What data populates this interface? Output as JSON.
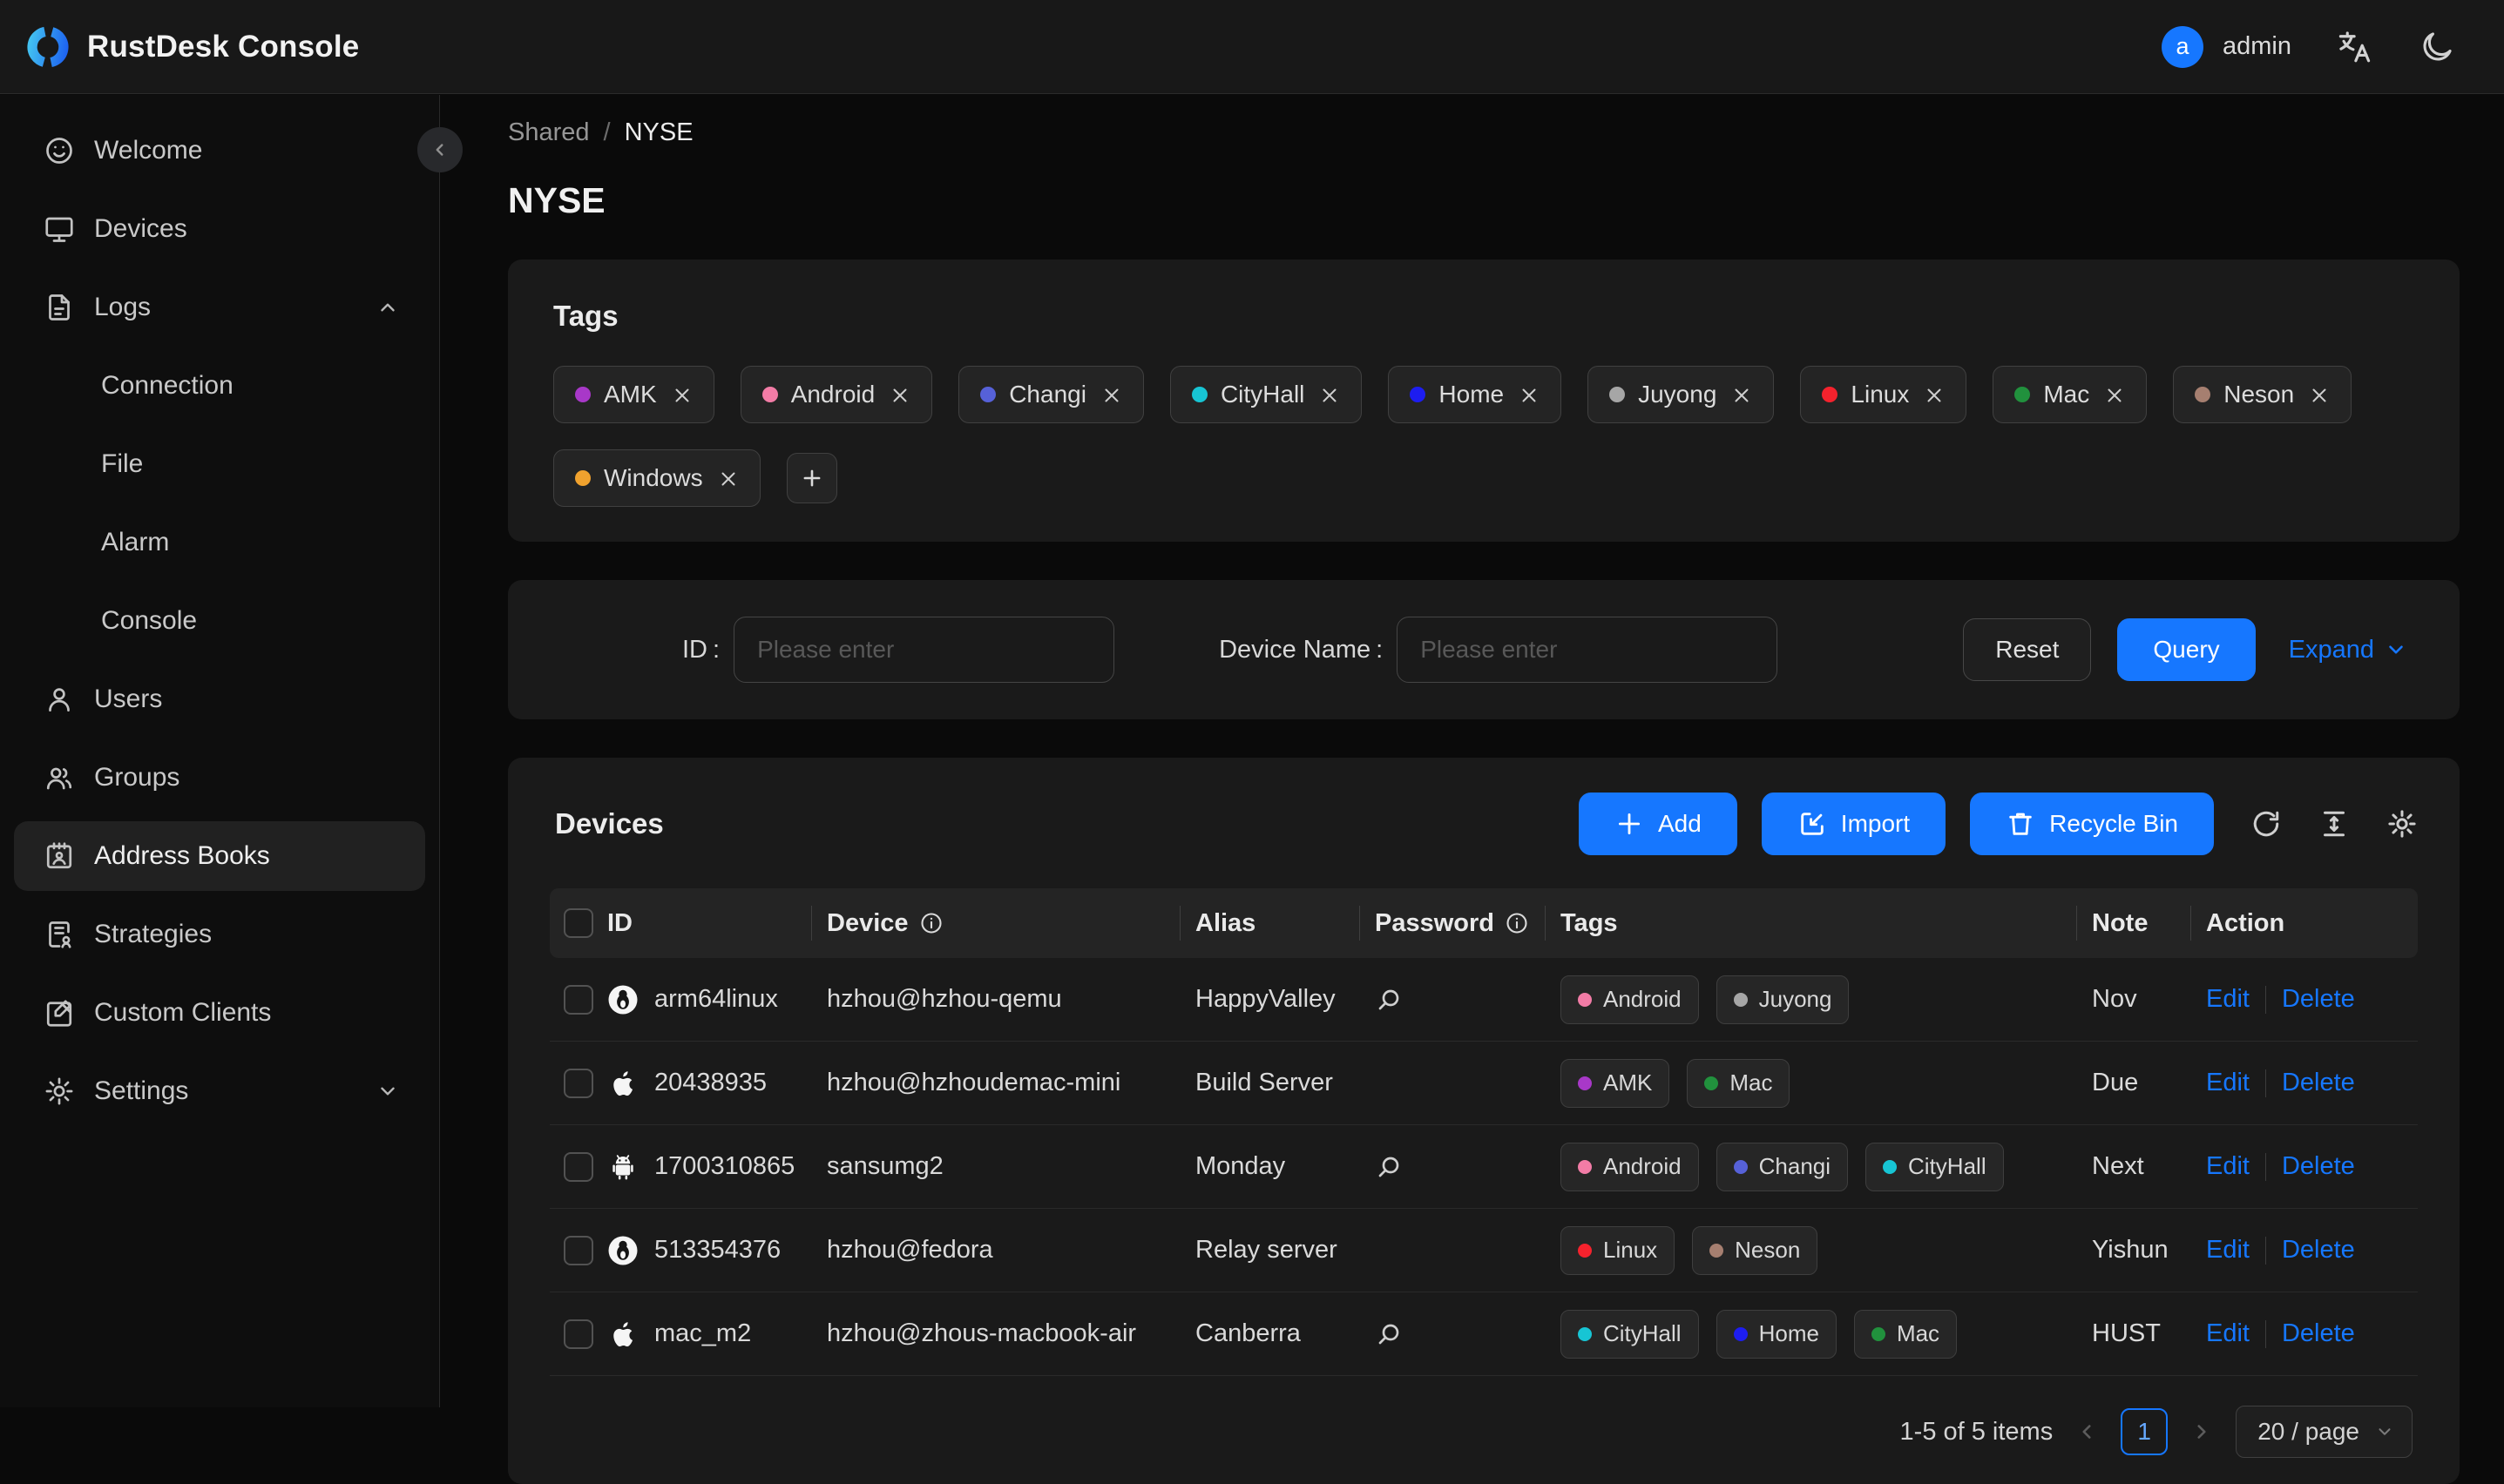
{
  "header": {
    "app_title": "RustDesk Console",
    "user_initial": "a",
    "user_name": "admin"
  },
  "sidebar": {
    "welcome": "Welcome",
    "devices": "Devices",
    "logs": "Logs",
    "connection": "Connection",
    "file": "File",
    "alarm": "Alarm",
    "console": "Console",
    "users": "Users",
    "groups": "Groups",
    "address_books": "Address Books",
    "strategies": "Strategies",
    "custom_clients": "Custom Clients",
    "settings": "Settings"
  },
  "breadcrumb": {
    "parent": "Shared",
    "separator": "/",
    "current": "NYSE"
  },
  "page_title": "NYSE",
  "tags_card": {
    "title": "Tags",
    "tags": [
      {
        "label": "AMK",
        "color": "#a838c8"
      },
      {
        "label": "Android",
        "color": "#f27ca6"
      },
      {
        "label": "Changi",
        "color": "#5661d8"
      },
      {
        "label": "CityHall",
        "color": "#17c5d4"
      },
      {
        "label": "Home",
        "color": "#1d1df0"
      },
      {
        "label": "Juyong",
        "color": "#a6a6a6"
      },
      {
        "label": "Linux",
        "color": "#f5222d"
      },
      {
        "label": "Mac",
        "color": "#21913d"
      },
      {
        "label": "Neson",
        "color": "#a67f70"
      },
      {
        "label": "Windows",
        "color": "#f0a22e"
      }
    ]
  },
  "filter": {
    "id_label": "ID",
    "device_name_label": "Device Name",
    "colon": ":",
    "id_placeholder": "Please enter",
    "device_placeholder": "Please enter",
    "reset": "Reset",
    "query": "Query",
    "expand": "Expand"
  },
  "devices_card": {
    "title": "Devices",
    "add": "Add",
    "import": "Import",
    "recycle_bin": "Recycle Bin"
  },
  "table": {
    "headers": {
      "id": "ID",
      "device": "Device",
      "alias": "Alias",
      "password": "Password",
      "tags": "Tags",
      "note": "Note",
      "action": "Action"
    },
    "edit": "Edit",
    "delete": "Delete",
    "rows": [
      {
        "os": "linux",
        "id": "arm64linux",
        "device": "hzhou@hzhou-qemu",
        "alias": "HappyValley",
        "note": "Nov",
        "tags": [
          {
            "label": "Android",
            "color": "#f27ca6"
          },
          {
            "label": "Juyong",
            "color": "#a6a6a6"
          }
        ]
      },
      {
        "os": "apple",
        "id": "20438935",
        "device": "hzhou@hzhoudemac-mini",
        "alias": "Build Server",
        "note": "Due",
        "tags": [
          {
            "label": "AMK",
            "color": "#a838c8"
          },
          {
            "label": "Mac",
            "color": "#21913d"
          }
        ]
      },
      {
        "os": "android",
        "id": "1700310865",
        "device": "sansumg2",
        "alias": "Monday",
        "note": "Next",
        "tags": [
          {
            "label": "Android",
            "color": "#f27ca6"
          },
          {
            "label": "Changi",
            "color": "#5661d8"
          },
          {
            "label": "CityHall",
            "color": "#17c5d4"
          }
        ]
      },
      {
        "os": "linux",
        "id": "513354376",
        "device": "hzhou@fedora",
        "alias": "Relay server",
        "note": "Yishun",
        "tags": [
          {
            "label": "Linux",
            "color": "#f5222d"
          },
          {
            "label": "Neson",
            "color": "#a67f70"
          }
        ]
      },
      {
        "os": "apple",
        "id": "mac_m2",
        "device": "hzhou@zhous-macbook-air",
        "alias": "Canberra",
        "note": "HUST",
        "tags": [
          {
            "label": "CityHall",
            "color": "#17c5d4"
          },
          {
            "label": "Home",
            "color": "#1d1df0"
          },
          {
            "label": "Mac",
            "color": "#21913d"
          }
        ]
      }
    ]
  },
  "pagination": {
    "total": "1-5 of 5 items",
    "page": "1",
    "page_size": "20 / page"
  },
  "colors": {
    "primary": "#1677ff"
  }
}
